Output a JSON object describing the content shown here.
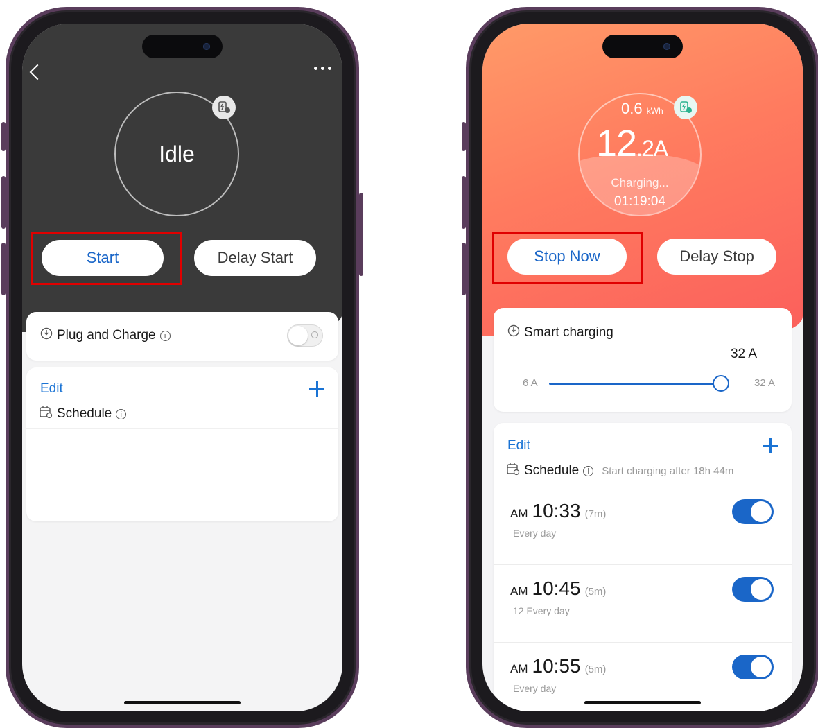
{
  "left_phone": {
    "status": "Idle",
    "buttons": {
      "start": "Start",
      "delay_start": "Delay Start"
    },
    "plug_and_charge": {
      "label": "Plug and Charge",
      "enabled": false
    },
    "schedule": {
      "edit_label": "Edit",
      "title": "Schedule"
    }
  },
  "right_phone": {
    "energy_value": "0.6",
    "energy_unit": "kWh",
    "current_int": "12",
    "current_dec": ".2A",
    "state": "Charging...",
    "elapsed": "01:19:04",
    "buttons": {
      "stop_now": "Stop Now",
      "delay_stop": "Delay Stop"
    },
    "smart_charging": {
      "label": "Smart charging",
      "current_value": "32 A",
      "min_label": "6 A",
      "max_label": "32 A",
      "level": 1.0
    },
    "schedule": {
      "edit_label": "Edit",
      "title": "Schedule",
      "note": "Start charging after 18h 44m",
      "items": [
        {
          "ampm": "AM",
          "time": "10:33",
          "duration": "(7m)",
          "repeat": "Every day",
          "enabled": true
        },
        {
          "ampm": "AM",
          "time": "10:45",
          "duration": "(5m)",
          "repeat": "12 Every day",
          "enabled": true
        },
        {
          "ampm": "AM",
          "time": "10:55",
          "duration": "(5m)",
          "repeat": "Every day",
          "enabled": true
        }
      ]
    }
  },
  "colors": {
    "accent_blue": "#1a73d4",
    "highlight_red": "#e00000",
    "idle_header": "#3a3a3a",
    "charging_gradient_start": "#ff9a68",
    "charging_gradient_end": "#fb5f5c",
    "phone_frame": "#5a3d5c"
  }
}
